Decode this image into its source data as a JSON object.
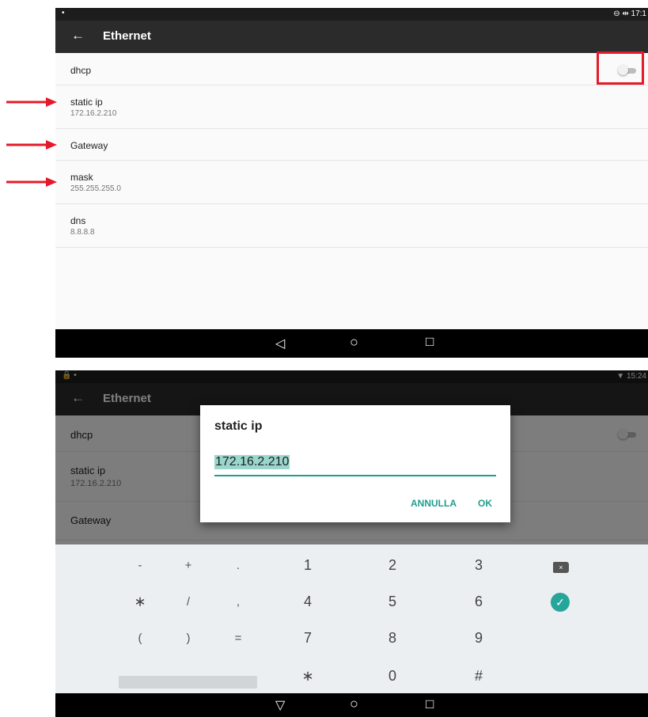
{
  "top": {
    "status": {
      "left": "•",
      "right": "⊖ ⇹ 17:1"
    },
    "toolbar": {
      "back": "←",
      "title": "Ethernet"
    },
    "rows": [
      {
        "title": "dhcp"
      },
      {
        "title": "static ip",
        "subtitle": "172.16.2.210"
      },
      {
        "title": "Gateway"
      },
      {
        "title": "mask",
        "subtitle": "255.255.255.0"
      },
      {
        "title": "dns",
        "subtitle": "8.8.8.8"
      }
    ],
    "dhcp_toggle_on": false,
    "nav": {
      "back": "◁",
      "home": "○",
      "recents": "□"
    }
  },
  "bottom": {
    "status": {
      "left": "🔒 •",
      "right": "▼ 15:24"
    },
    "toolbar": {
      "back": "←",
      "title": "Ethernet"
    },
    "rows": [
      {
        "title": "dhcp"
      },
      {
        "title": "static ip",
        "subtitle": "172.16.2.210"
      },
      {
        "title": "Gateway"
      }
    ],
    "dialog": {
      "title": "static ip",
      "value": "172.16.2.210",
      "cancel": "ANNULLA",
      "ok": "OK"
    },
    "keyboard": {
      "row1": [
        "-",
        "+",
        ".",
        "1",
        "2",
        "3"
      ],
      "row2": [
        "∗",
        "/",
        ",",
        "4",
        "5",
        "6"
      ],
      "row3": [
        "(",
        ")",
        "=",
        "7",
        "8",
        "9"
      ],
      "row4": [
        "∗",
        "0",
        "#"
      ],
      "delete": "×",
      "done": "✓"
    },
    "nav": {
      "back": "▽",
      "home": "○",
      "recents": "□"
    }
  },
  "annotation_color": "#e5192a",
  "accent": "#1e9e8e"
}
